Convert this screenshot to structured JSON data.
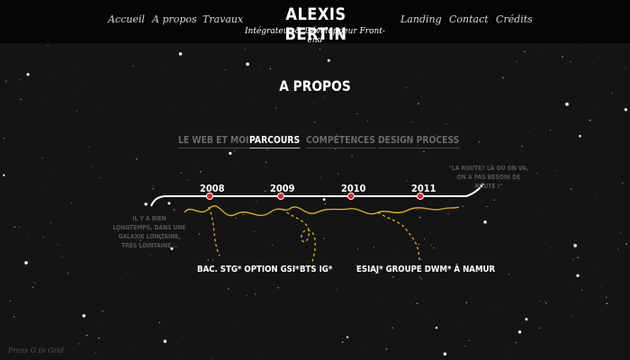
{
  "header": {
    "nav_left": [
      "Accueil",
      "A propos",
      "Travaux"
    ],
    "nav_right": [
      "Landing",
      "Contact",
      "Crédits"
    ],
    "brand_name": "ALEXIS BERTIN",
    "brand_subtitle": "Intégrateur & Développeur Front-end"
  },
  "section": {
    "title": "A PROPOS",
    "tabs": [
      {
        "label": "LE WEB ET MOI",
        "active": false
      },
      {
        "label": "PARCOURS",
        "active": true
      },
      {
        "label": "COMPÉTENCES",
        "active": false
      },
      {
        "label": "DESIGN PROCESS",
        "active": false
      }
    ]
  },
  "timeline": {
    "years": [
      "2008",
      "2009",
      "2010",
      "2011"
    ],
    "intro_note": "IL Y A BIEN LONGTEMPS, DANS UNE GALAXIE LOINTAINE, TRÈS LOINTAINE...",
    "end_note": "\"LA ROUTE? LÀ OÙ ON VA, ON A PAS BESOIN DE ROUTE !\"",
    "milestones": [
      "BAC. STG* OPTION GSI*",
      "BTS IG*",
      "ESIAJ* GROUPE DWM* À NAMUR"
    ],
    "line_color": "#ffffff",
    "marker_color": "#e0262a",
    "path_color": "#e8b21a"
  },
  "footer": {
    "grid_hint": "Press G to Grid"
  }
}
